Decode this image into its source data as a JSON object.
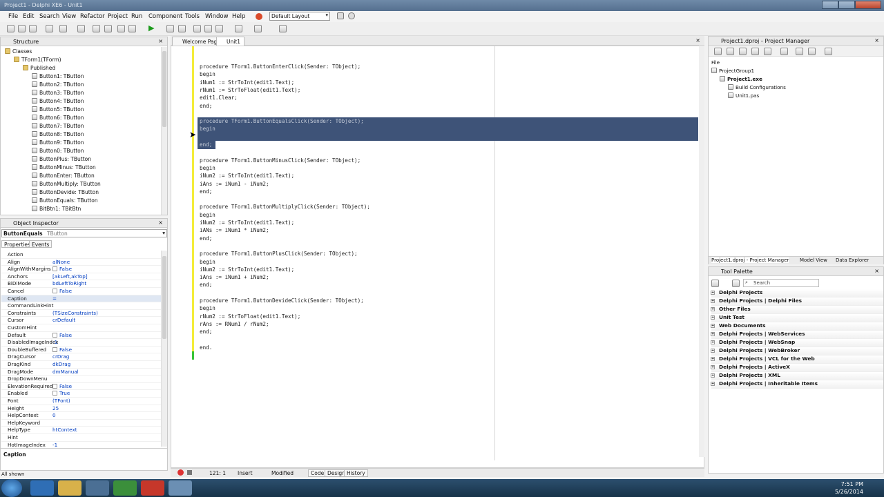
{
  "window": {
    "title": "Project1 - Delphi XE6 - Unit1"
  },
  "menu": [
    "File",
    "Edit",
    "Search",
    "View",
    "Refactor",
    "Project",
    "Run",
    "Component",
    "Tools",
    "Window",
    "Help"
  ],
  "layout": {
    "selected": "Default Layout"
  },
  "structure": {
    "title": "Structure",
    "items": [
      {
        "label": "Classes",
        "depth": 0
      },
      {
        "label": "TForm1(TForm)",
        "depth": 1
      },
      {
        "label": "Published",
        "depth": 2
      },
      {
        "label": "Button1: TButton",
        "depth": 3
      },
      {
        "label": "Button2: TButton",
        "depth": 3
      },
      {
        "label": "Button3: TButton",
        "depth": 3
      },
      {
        "label": "Button4: TButton",
        "depth": 3
      },
      {
        "label": "Button5: TButton",
        "depth": 3
      },
      {
        "label": "Button6: TButton",
        "depth": 3
      },
      {
        "label": "Button7: TButton",
        "depth": 3
      },
      {
        "label": "Button8: TButton",
        "depth": 3
      },
      {
        "label": "Button9: TButton",
        "depth": 3
      },
      {
        "label": "Button0: TButton",
        "depth": 3
      },
      {
        "label": "ButtonPlus: TButton",
        "depth": 3
      },
      {
        "label": "ButtonMinus: TButton",
        "depth": 3
      },
      {
        "label": "ButtonEnter: TButton",
        "depth": 3
      },
      {
        "label": "ButtonMultiply: TButton",
        "depth": 3
      },
      {
        "label": "ButtonDevide: TButton",
        "depth": 3
      },
      {
        "label": "ButtonEquals: TButton",
        "depth": 3
      },
      {
        "label": "BitBtn1: TBitBtn",
        "depth": 3
      }
    ]
  },
  "inspector": {
    "title": "Object Inspector",
    "selected_object": "ButtonEquals",
    "selected_type": "TButton",
    "tabs": [
      "Properties",
      "Events"
    ],
    "properties": [
      {
        "name": "Action",
        "value": ""
      },
      {
        "name": "Align",
        "value": "alNone"
      },
      {
        "name": "AlignWithMargins",
        "value": "False",
        "check": true
      },
      {
        "name": "Anchors",
        "value": "[akLeft,akTop]"
      },
      {
        "name": "BiDiMode",
        "value": "bdLeftToRight"
      },
      {
        "name": "Cancel",
        "value": "False",
        "check": true
      },
      {
        "name": "Caption",
        "value": "=",
        "selected": true
      },
      {
        "name": "CommandLinkHint",
        "value": ""
      },
      {
        "name": "Constraints",
        "value": "(TSizeConstraints)"
      },
      {
        "name": "Cursor",
        "value": "crDefault"
      },
      {
        "name": "CustomHint",
        "value": ""
      },
      {
        "name": "Default",
        "value": "False",
        "check": true
      },
      {
        "name": "DisabledImageIndex",
        "value": "-1"
      },
      {
        "name": "DoubleBuffered",
        "value": "False",
        "check": true
      },
      {
        "name": "DragCursor",
        "value": "crDrag"
      },
      {
        "name": "DragKind",
        "value": "dkDrag"
      },
      {
        "name": "DragMode",
        "value": "dmManual"
      },
      {
        "name": "DropDownMenu",
        "value": ""
      },
      {
        "name": "ElevationRequired",
        "value": "False",
        "check": true
      },
      {
        "name": "Enabled",
        "value": "True",
        "check": true
      },
      {
        "name": "Font",
        "value": "(TFont)"
      },
      {
        "name": "Height",
        "value": "25"
      },
      {
        "name": "HelpContext",
        "value": "0"
      },
      {
        "name": "HelpKeyword",
        "value": ""
      },
      {
        "name": "HelpType",
        "value": "htContext"
      },
      {
        "name": "Hint",
        "value": ""
      },
      {
        "name": "HotImageIndex",
        "value": "-1"
      }
    ],
    "status_label": "Caption",
    "all_shown": "All shown"
  },
  "editor": {
    "tabs": [
      "Welcome Page",
      "Unit1"
    ],
    "lines": [
      {
        "text": "procedure TForm1.ButtonEnterClick(Sender: TObject);",
        "selected": false
      },
      {
        "text": "begin",
        "selected": false
      },
      {
        "text": "iNum1 := StrToInt(edit1.Text);",
        "selected": false
      },
      {
        "text": "rNum1 := StrToFloat(edit1.Text);",
        "selected": false
      },
      {
        "text": "edit1.Clear;",
        "selected": false
      },
      {
        "text": "end;",
        "selected": false
      },
      {
        "text": "",
        "selected": false
      },
      {
        "text": "procedure TForm1.ButtonEqualsClick(Sender: TObject);",
        "selected": true
      },
      {
        "text": "begin",
        "selected": true
      },
      {
        "text": "",
        "selected": true
      },
      {
        "text": "end;",
        "selected": true
      },
      {
        "text": "",
        "selected": false
      },
      {
        "text": "procedure TForm1.ButtonMinusClick(Sender: TObject);",
        "selected": false
      },
      {
        "text": "begin",
        "selected": false
      },
      {
        "text": "iNum2 := StrToInt(edit1.Text);",
        "selected": false
      },
      {
        "text": "iAns := iNum1 - iNum2;",
        "selected": false
      },
      {
        "text": "end;",
        "selected": false
      },
      {
        "text": "",
        "selected": false
      },
      {
        "text": "procedure TForm1.ButtonMultiplyClick(Sender: TObject);",
        "selected": false
      },
      {
        "text": "begin",
        "selected": false
      },
      {
        "text": "iNum2 := StrToInt(edit1.Text);",
        "selected": false
      },
      {
        "text": "iANs := iNum1 * iNum2;",
        "selected": false
      },
      {
        "text": "end;",
        "selected": false
      },
      {
        "text": "",
        "selected": false
      },
      {
        "text": "procedure TForm1.ButtonPlusClick(Sender: TObject);",
        "selected": false
      },
      {
        "text": "begin",
        "selected": false
      },
      {
        "text": "iNum2 := StrToInt(edit1.Text);",
        "selected": false
      },
      {
        "text": "iAns := iNum1 + iNum2;",
        "selected": false
      },
      {
        "text": "end;",
        "selected": false
      },
      {
        "text": "",
        "selected": false
      },
      {
        "text": "procedure TForm1.ButtonDevideClick(Sender: TObject);",
        "selected": false
      },
      {
        "text": "begin",
        "selected": false
      },
      {
        "text": "rNum2 := StrToFloat(edit1.Text);",
        "selected": false
      },
      {
        "text": "rAns := RNum1 / rNum2;",
        "selected": false
      },
      {
        "text": "end;",
        "selected": false
      },
      {
        "text": "",
        "selected": false
      },
      {
        "text": "end.",
        "selected": false
      }
    ],
    "status": {
      "position": "121: 1",
      "mode": "Insert",
      "state": "Modified",
      "views": [
        "Code",
        "Design",
        "History"
      ]
    }
  },
  "project_manager": {
    "title": "Project1.dproj - Project Manager",
    "header": "File",
    "items": [
      {
        "label": "ProjectGroup1",
        "depth": 0,
        "bold": false
      },
      {
        "label": "Project1.exe",
        "depth": 1,
        "bold": true
      },
      {
        "label": "Build Configurations",
        "depth": 2,
        "bold": false
      },
      {
        "label": "Unit1.pas",
        "depth": 2,
        "bold": false
      }
    ],
    "bottom_tabs": [
      "Project1.dproj - Project Manager",
      "Model View",
      "Data Explorer"
    ]
  },
  "tool_palette": {
    "title": "Tool Palette",
    "search_placeholder": "Search",
    "categories": [
      "Delphi Projects",
      "Delphi Projects | Delphi Files",
      "Other Files",
      "Unit Test",
      "Web Documents",
      "Delphi Projects | WebServices",
      "Delphi Projects | WebSnap",
      "Delphi Projects | WebBroker",
      "Delphi Projects | VCL for the Web",
      "Delphi Projects | ActiveX",
      "Delphi Projects | XML",
      "Delphi Projects | Inheritable Items"
    ]
  },
  "taskbar": {
    "time": "7:51 PM",
    "date": "5/26/2014"
  }
}
